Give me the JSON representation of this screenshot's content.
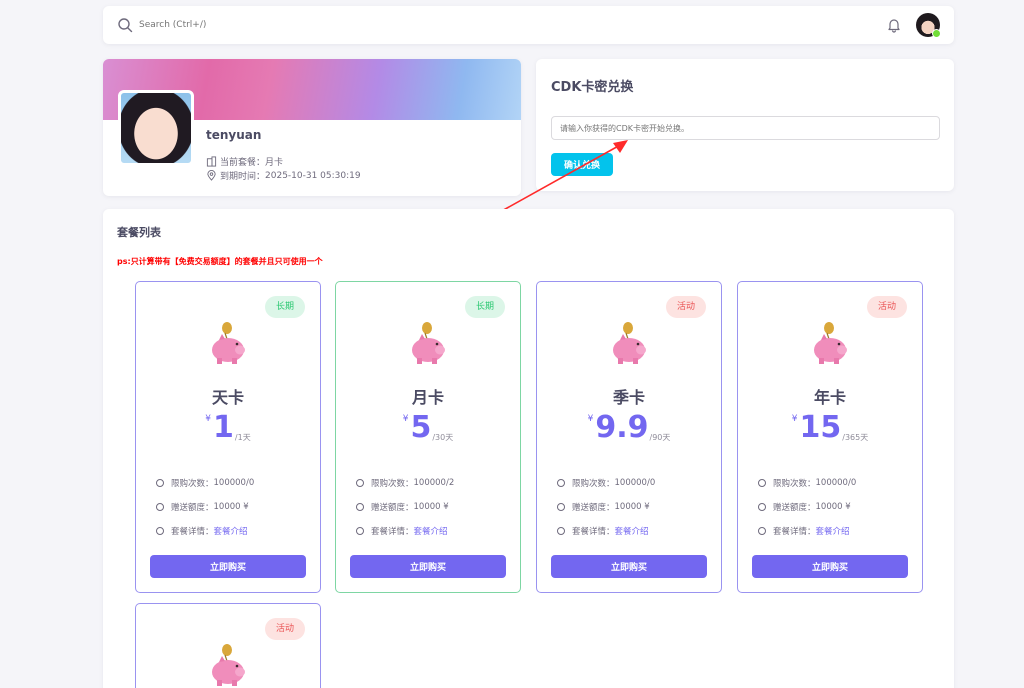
{
  "topbar": {
    "search_placeholder": "Search (Ctrl+/)"
  },
  "profile": {
    "username": "tenyuan",
    "plan_label": "当前套餐：",
    "plan_value": "月卡",
    "expiry_label": "到期时间：",
    "expiry_value": "2025-10-31 05:30:19"
  },
  "cdk": {
    "title": "CDK卡密兑换",
    "input_placeholder": "请输入你获得的CDK卡密开始兑换。",
    "button_label": "确认兑换"
  },
  "plans_section": {
    "title": "套餐列表",
    "note": "ps:只计算带有【免费交易额度】的套餐并且只可使用一个"
  },
  "plans": [
    {
      "badge": "长期",
      "name": "天卡",
      "currency": "¥",
      "price": "1",
      "period": "/1天",
      "limit_label": "限购次数：",
      "limit": "100000/0",
      "bonus_label": "赠送额度：",
      "bonus": "10000 ¥",
      "detail_label": "套餐详情：",
      "detail_link": "套餐介绍",
      "buy_label": "立即购买"
    },
    {
      "badge": "长期",
      "name": "月卡",
      "currency": "¥",
      "price": "5",
      "period": "/30天",
      "limit_label": "限购次数：",
      "limit": "100000/2",
      "bonus_label": "赠送额度：",
      "bonus": "10000 ¥",
      "detail_label": "套餐详情：",
      "detail_link": "套餐介绍",
      "buy_label": "立即购买"
    },
    {
      "badge": "活动",
      "name": "季卡",
      "currency": "¥",
      "price": "9.9",
      "period": "/90天",
      "limit_label": "限购次数：",
      "limit": "100000/0",
      "bonus_label": "赠送额度：",
      "bonus": "10000 ¥",
      "detail_label": "套餐详情：",
      "detail_link": "套餐介绍",
      "buy_label": "立即购买"
    },
    {
      "badge": "活动",
      "name": "年卡",
      "currency": "¥",
      "price": "15",
      "period": "/365天",
      "limit_label": "限购次数：",
      "limit": "100000/0",
      "bonus_label": "赠送额度：",
      "bonus": "10000 ¥",
      "detail_label": "套餐详情：",
      "detail_link": "套餐介绍",
      "buy_label": "立即购买"
    },
    {
      "badge": "活动"
    }
  ],
  "colors": {
    "primary": "#7367f0",
    "info": "#03c3ec",
    "success": "#28c76f",
    "danger": "#ea5455",
    "annotation": "#ff0000"
  }
}
